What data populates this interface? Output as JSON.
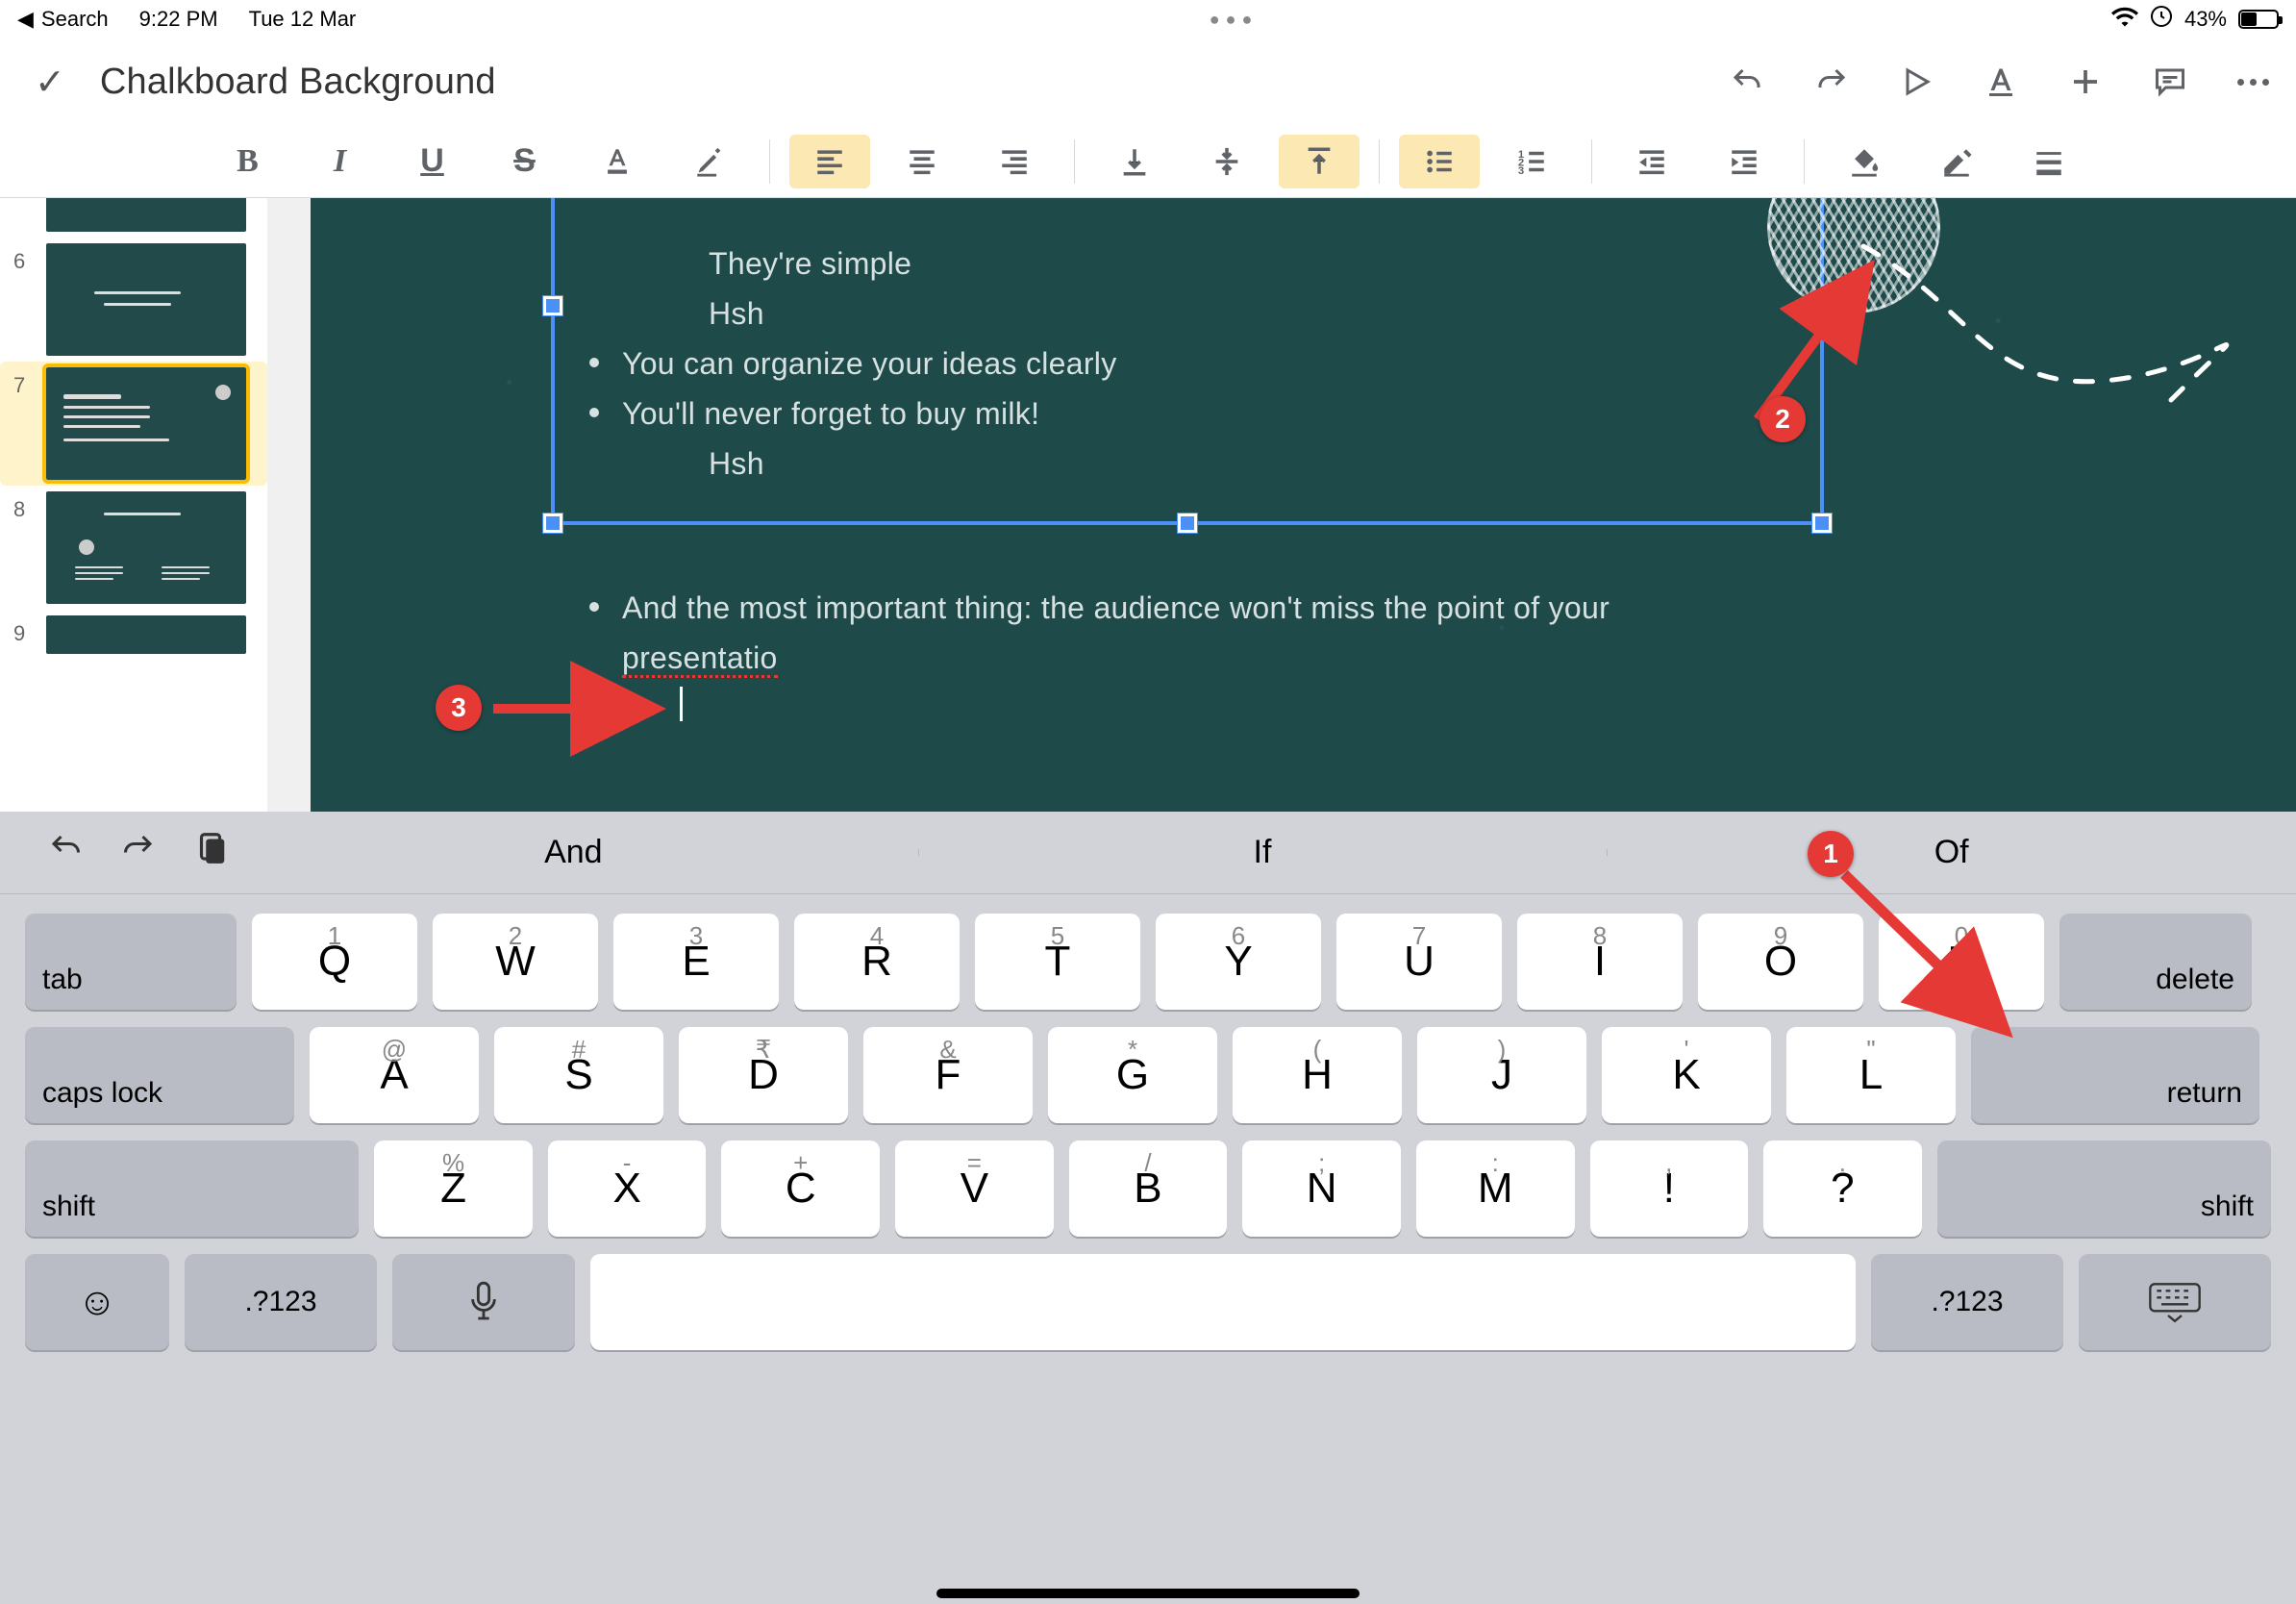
{
  "status": {
    "back_label": "Search",
    "time": "9:22 PM",
    "date": "Tue 12 Mar",
    "battery_pct": "43%",
    "battery_fill_pct": 43
  },
  "header": {
    "doc_title": "Chalkboard Background"
  },
  "slide": {
    "bullets": {
      "b1": "They're simple",
      "b1s": "Hsh",
      "b2": "You can organize your ideas clearly",
      "b3": "You'll never forget to buy milk!",
      "b3s": "Hsh"
    },
    "outside_line1": "And the most important thing: the audience won't miss the point of your",
    "outside_line2": "presentatio"
  },
  "thumbs": {
    "n6": "6",
    "n7": "7",
    "n8": "8",
    "n9": "9"
  },
  "anno": {
    "l1": "1",
    "l2": "2",
    "l3": "3"
  },
  "kbd": {
    "sugg1": "And",
    "sugg2": "If",
    "sugg3": "Of",
    "tab": "tab",
    "delete": "delete",
    "caps": "caps lock",
    "return": "return",
    "shift": "shift",
    "numsym": ".?123",
    "r1": {
      "h1": "1",
      "h2": "2",
      "h3": "3",
      "h4": "4",
      "h5": "5",
      "h6": "6",
      "h7": "7",
      "h8": "8",
      "h9": "9",
      "h0": "0",
      "k1": "Q",
      "k2": "W",
      "k3": "E",
      "k4": "R",
      "k5": "T",
      "k6": "Y",
      "k7": "U",
      "k8": "I",
      "k9": "O",
      "k0": "P"
    },
    "r2": {
      "h1": "@",
      "h2": "#",
      "h3": "₹",
      "h4": "&",
      "h5": "*",
      "h6": "(",
      "h7": ")",
      "h8": "'",
      "h9": "\"",
      "k1": "A",
      "k2": "S",
      "k3": "D",
      "k4": "F",
      "k5": "G",
      "k6": "H",
      "k7": "J",
      "k8": "K",
      "k9": "L"
    },
    "r3": {
      "h1": "%",
      "h2": "-",
      "h3": "+",
      "h4": "=",
      "h5": "/",
      "h6": ";",
      "h7": ":",
      "k1": "Z",
      "k2": "X",
      "k3": "C",
      "k4": "V",
      "k5": "B",
      "k6": "N",
      "k7": "M",
      "k8": "!",
      "k9": "?",
      "hp1": ",",
      "hp2": "."
    }
  }
}
